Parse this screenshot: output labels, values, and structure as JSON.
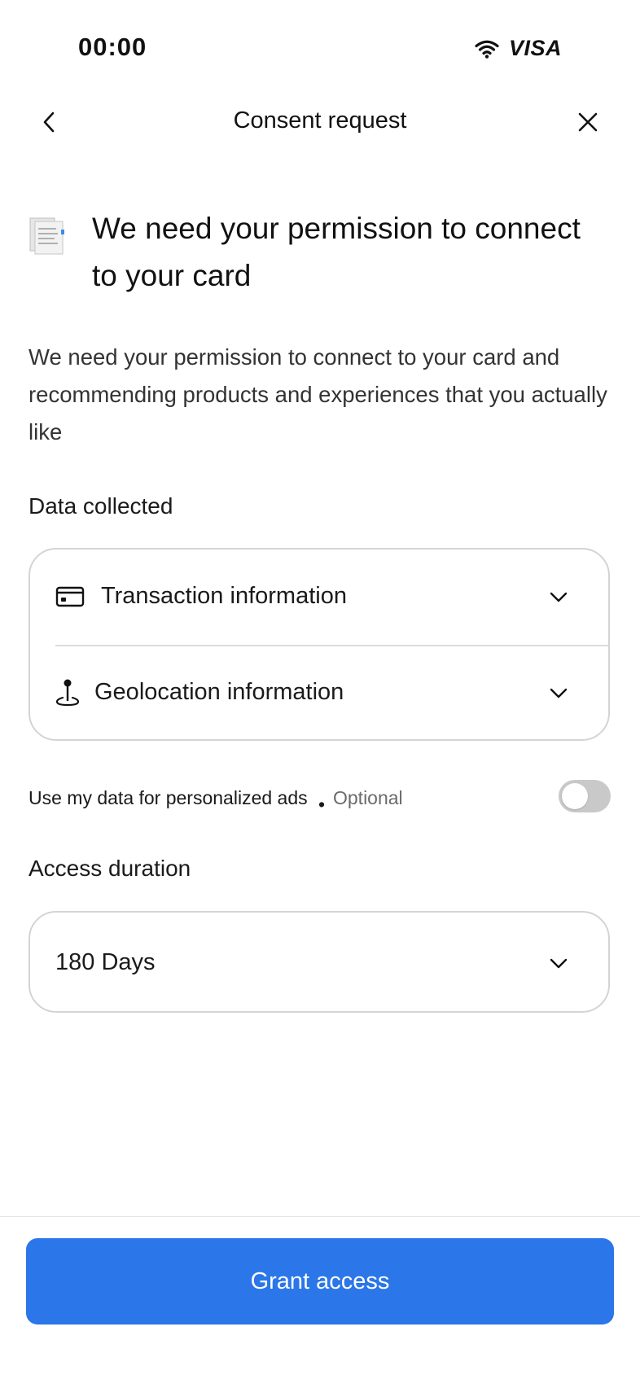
{
  "status_bar": {
    "time": "00:00",
    "brand": "VISA",
    "wifi_icon": "wifi-icon"
  },
  "nav": {
    "title": "Consent request",
    "back_icon": "chevron-left-icon",
    "close_icon": "close-icon"
  },
  "header": {
    "icon": "document-icon",
    "title": "We need your permission to connect to your card"
  },
  "description": "We need your permission to connect to your card and recommending products and experiences that you actually like",
  "data_collected": {
    "label": "Data collected",
    "items": [
      {
        "label": "Transaction information",
        "icon": "credit-card-icon",
        "chevron": "chevron-down-icon"
      },
      {
        "label": "Geolocation information",
        "icon": "location-pin-icon",
        "chevron": "chevron-down-icon"
      }
    ]
  },
  "personalized_ads": {
    "label": "Use my data for personalized ads",
    "separator": "•",
    "optional": "Optional",
    "enabled": false
  },
  "access_duration": {
    "label": "Access duration",
    "value": "180 Days",
    "chevron": "chevron-down-icon"
  },
  "primary_action": {
    "label": "Grant access",
    "color": "#2b76e8"
  }
}
